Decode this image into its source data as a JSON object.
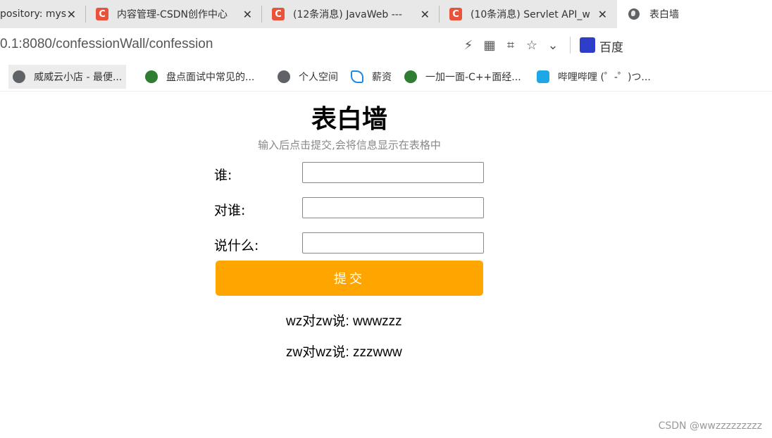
{
  "browser": {
    "tabs": [
      {
        "title": "pository: mys",
        "icon": "github-icon",
        "active": false
      },
      {
        "title": "内容管理-CSDN创作中心",
        "icon": "csdn-icon",
        "active": false
      },
      {
        "title": "(12条消息) JavaWeb ---",
        "icon": "csdn-icon",
        "active": false
      },
      {
        "title": "(10条消息) Servlet API_w",
        "icon": "csdn-icon",
        "active": false
      },
      {
        "title": "表白墙",
        "icon": "globe-icon",
        "active": true
      }
    ],
    "close_glyph": "✕",
    "url": "0.1:8080/confessionWall/confession",
    "search_engine": "百度",
    "bookmarks": [
      {
        "label": "威威云小店 - 最便...",
        "icon": "globe-icon"
      },
      {
        "label": "盘点面试中常见的...",
        "icon": "shield-icon"
      },
      {
        "label": "个人空间",
        "icon": "globe-icon"
      },
      {
        "label": "薪资",
        "icon": "leaf-icon"
      },
      {
        "label": "一加一面-C++面经...",
        "icon": "shield-icon"
      },
      {
        "label": "哔哩哔哩 (゜-゜)つ...",
        "icon": "bilibili-icon"
      }
    ]
  },
  "page": {
    "title": "表白墙",
    "subtitle": "输入后点击提交,会将信息显示在表格中",
    "form": {
      "from_label": "谁:",
      "to_label": "对谁:",
      "message_label": "说什么:",
      "from_value": "",
      "to_value": "",
      "message_value": "",
      "submit_label": "提交"
    },
    "messages": [
      "wz对zw说: wwwzzz",
      "zw对wz说: zzzwww"
    ]
  },
  "watermark": "CSDN @wwzzzzzzzzz",
  "colors": {
    "submit_bg": "#ffa500",
    "tabbar_bg": "#e8e8e8",
    "csdn_red": "#e8533a"
  }
}
